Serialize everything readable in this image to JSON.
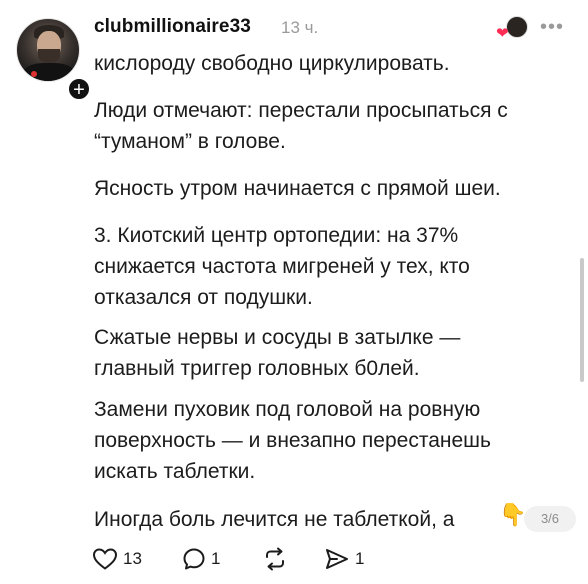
{
  "post": {
    "username": "clubmillionaire33",
    "time": "13 ч.",
    "paragraphs": [
      "кислороду свободно циркулировать.",
      "Люди отмечают: перестали просыпаться с\n“туманом” в голове.",
      "Ясность утром начинается с прямой шеи.",
      "3. Киотский центр ортопедии: на 37%\nснижается частота мигреней у тех, кто\nотказался от подушки.",
      "Сжатые нервы и сосуды в затылке —\nглавный триггер головных б0лей.",
      "Замени пуховик под головой на ровную\nповерхность — и внезапно перестанешь\nискать таблетки.",
      "Иногда боль лечится не таблеткой, а"
    ],
    "trailing_emoji": "👇",
    "page_indicator": "3/6"
  },
  "actions": {
    "likes": "13",
    "comments": "1",
    "reposts": "",
    "shares": "1"
  },
  "icons": {
    "like": "heart-outline-icon",
    "comment": "comment-bubble-icon",
    "repost": "repost-arrows-icon",
    "share": "send-icon",
    "more": "more-dots-icon",
    "follow": "plus-icon"
  },
  "colors": {
    "accent_heart": "#ff2d55",
    "text": "#1c1c1c",
    "muted": "#9a9a9a"
  }
}
